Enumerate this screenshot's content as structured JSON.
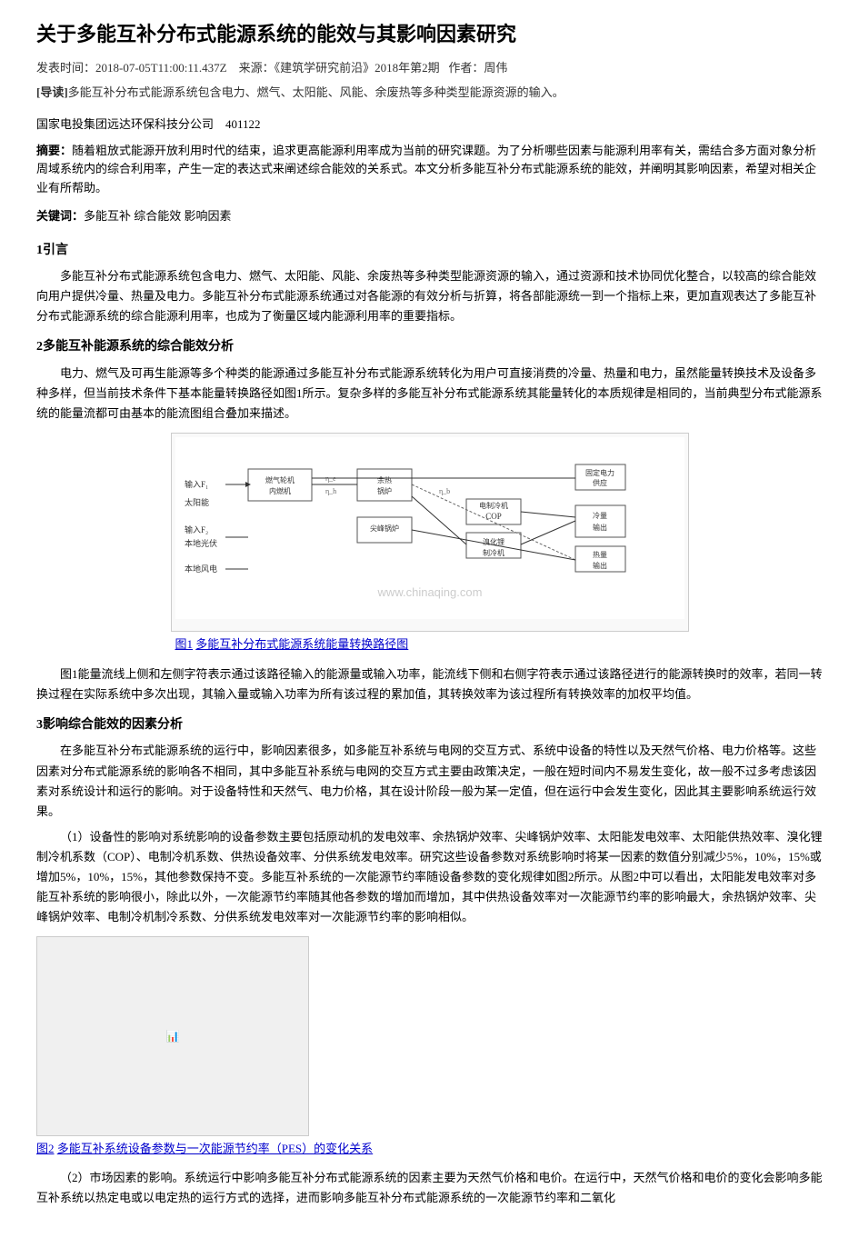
{
  "title": "关于多能互补分布式能源系统的能效与其影响因素研究",
  "meta": {
    "publish_time_label": "发表时间：",
    "publish_time": "2018-07-05T11:00:11.437Z",
    "source_label": "来源：",
    "source": "《建筑学研究前沿》2018年第2期",
    "author_label": "作者：",
    "author": "周伟"
  },
  "guide": {
    "prefix": "[导读]",
    "text": "多能互补分布式能源系统包含电力、燃气、太阳能、风能、余废热等多种类型能源资源的输入。"
  },
  "org": {
    "name": "国家电投集团远达环保科技分公司",
    "code": "401122"
  },
  "abstract": {
    "label": "摘要：",
    "text": "随着粗放式能源开放利用时代的结束，追求更高能源利用率成为当前的研究课题。为了分析哪些因素与能源利用率有关，需结合多方面对象分析周域系统内的综合利用率，产生一定的表达式来阐述综合能效的关系式。本文分析多能互补分布式能源系统的能效，并阐明其影响因素，希望对相关企业有所帮助。"
  },
  "keywords": {
    "label": "关键词：",
    "items": "多能互补  综合能效  影响因素"
  },
  "section1": {
    "title": "1引言",
    "paragraph": "多能互补分布式能源系统包含电力、燃气、太阳能、风能、余废热等多种类型能源资源的输入，通过资源和技术协同优化整合，以较高的综合能效向用户提供冷量、热量及电力。多能互补分布式能源系统通过对各能源的有效分析与折算，将各部能源统一到一个指标上来，更加直观表达了多能互补分布式能源系统的综合能源利用率，也成为了衡量区域内能源利用率的重要指标。"
  },
  "section2": {
    "title": "2多能互补能源系统的综合能效分析",
    "paragraph": "电力、燃气及可再生能源等多个种类的能源通过多能互补分布式能源系统转化为用户可直接消费的冷量、热量和电力，虽然能量转换技术及设备多种多样，但当前技术条件下基本能量转换路径如图1所示。复杂多样的多能互补分布式能源系统其能量转化的本质规律是相同的，当前典型分布式能源系统的能量流都可由基本的能流图组合叠加来描述。",
    "figure1": {
      "caption_prefix": "图1",
      "caption_main": "多能互补分布式能源系统能量转换路径图",
      "caption_underline": true
    },
    "figure1_desc": "图1能量流线上侧和左侧字符表示通过该路径输入的能源量或输入功率，能流线下侧和右侧字符表示通过该路径进行的能源转换时的效率，若同一转换过程在实际系统中多次出现，其输入量或输入功率为所有该过程的累加值，其转换效率为该过程所有转换效率的加权平均值。"
  },
  "section3": {
    "title": "3影响综合能效的因素分析",
    "paragraph1": "在多能互补分布式能源系统的运行中，影响因素很多，如多能互补系统与电网的交互方式、系统中设备的特性以及天然气价格、电力价格等。这些因素对分布式能源系统的影响各不相同，其中多能互补系统与电网的交互方式主要由政策决定，一般在短时间内不易发生变化，故一般不过多考虑该因素对系统设计和运行的影响。对于设备特性和天然气、电力价格，其在设计阶段一般为某一定值，但在运行中会发生变化，因此其主要影响系统运行效果。",
    "sub1_label": "（1）",
    "sub1_text": "设备性的影响对系统影响的设备参数主要包括原动机的发电效率、余热锅炉效率、尖峰锅炉效率、太阳能发电效率、太阳能供热效率、溴化锂制冷机系数（COP）、电制冷机系数、供热设备效率、分供系统发电效率。研究这些设备参数对系统影响时将某一因素的数值分别减少5%，10%，15%或增加5%，10%，15%，其他参数保持不变。多能互补系统的一次能源节约率随设备参数的变化规律如图2所示。从图2中可以看出，太阳能发电效率对多能互补系统的影响很小，除此以外，一次能源节约率随其他各参数的增加而增加，其中供热设备效率对一次能源节约率的影响最大，余热锅炉效率、尖峰锅炉效率、电制冷机制冷系数、分供系统发电效率对一次能源节约率的影响相似。",
    "figure2": {
      "caption_prefix": "图2",
      "caption_main": "多能互补系统设备参数与一次能源节约率（PES）的变化关系"
    },
    "sub2_label": "（2）",
    "sub2_text": "市场因素的影响。系统运行中影响多能互补分布式能源系统的因素主要为天然气价格和电价。在运行中，天然气价格和电价的变化会影响多能互补系统以热定电或以电定热的运行方式的选择，进而影响多能互补分布式能源系统的一次能源节约率和二氧化"
  },
  "cop_label": "COP",
  "watermark_text": "www.chinaqing.com"
}
